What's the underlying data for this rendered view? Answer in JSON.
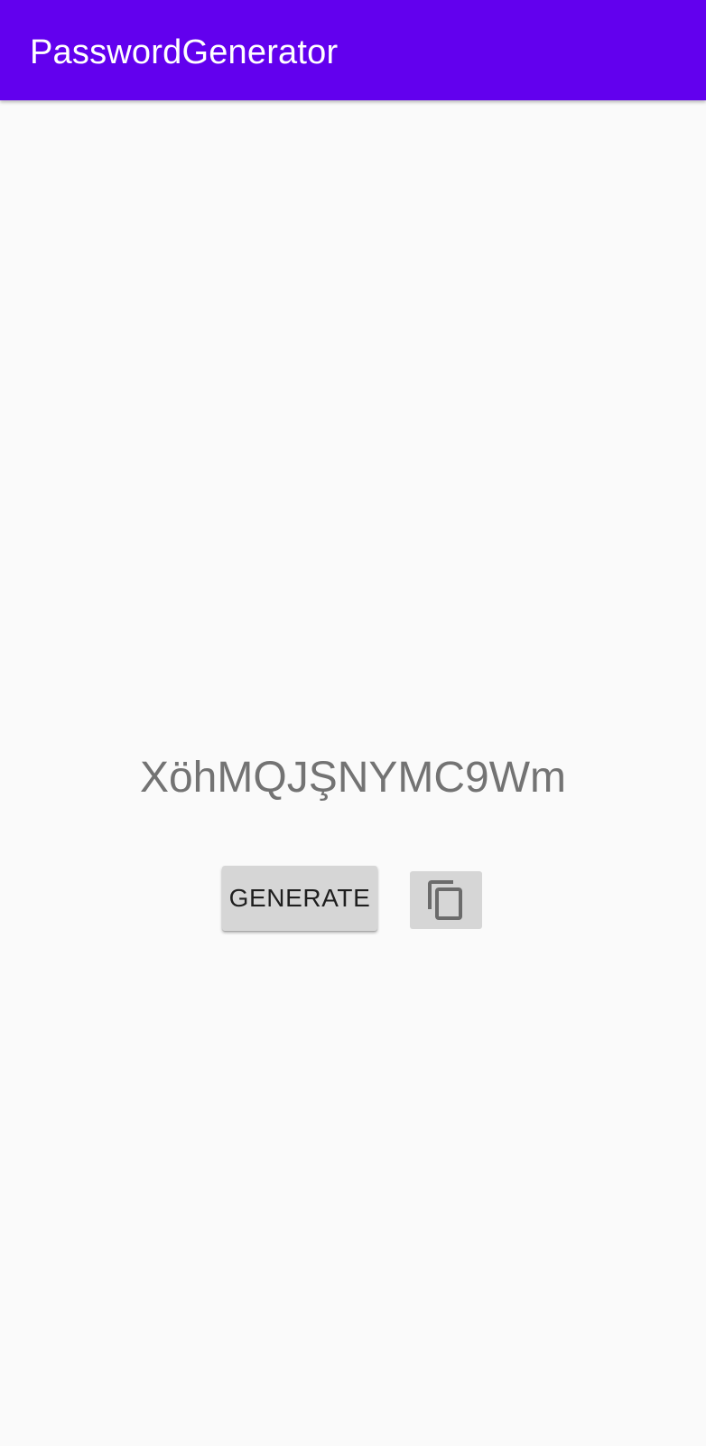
{
  "app_bar": {
    "title": "PasswordGenerator",
    "background_color": "#6200ee",
    "title_color": "#ffffff"
  },
  "main": {
    "password_value": "XöhMQJŞNYMC9Wm",
    "generate_button_label": "GENERATE",
    "copy_button_icon": "content-copy-icon"
  }
}
